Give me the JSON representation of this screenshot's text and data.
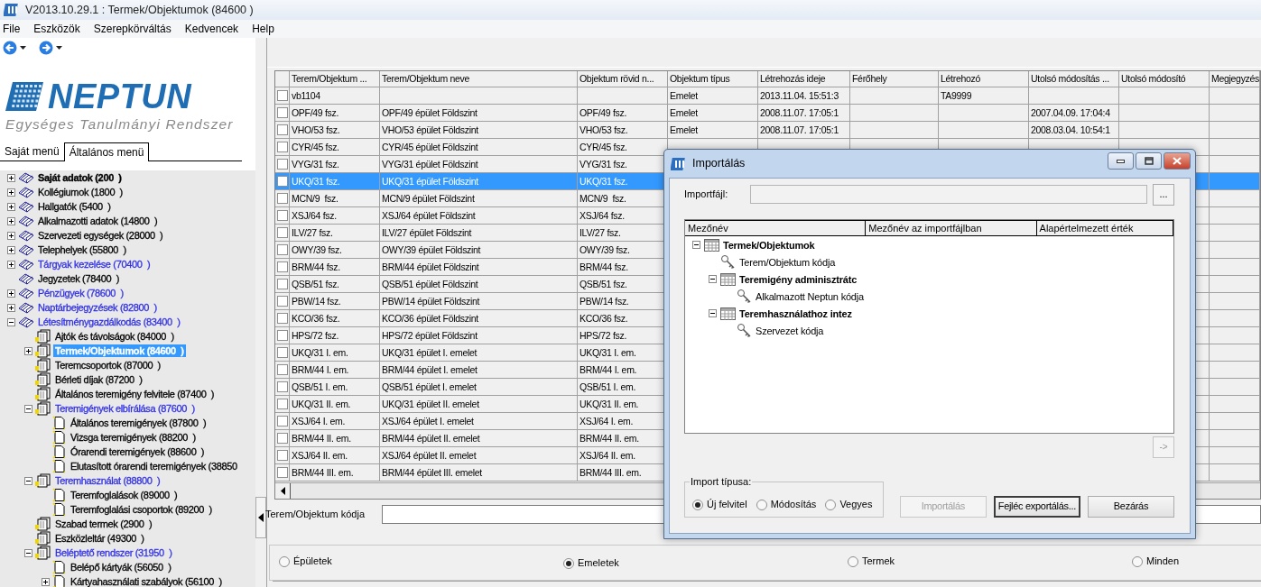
{
  "window": {
    "title": "V2013.10.29.1 : Termek/Objektumok (84600  )"
  },
  "menu": [
    "File",
    "Eszközök",
    "Szerepkörváltás",
    "Kedvencek",
    "Help"
  ],
  "logo": {
    "name": "NEPTUN",
    "tagline": "Egységes Tanulmányi Rendszer"
  },
  "sidebar": {
    "tabs": [
      {
        "label": "Saját menü",
        "selected": false
      },
      {
        "label": "Általános menü",
        "selected": true
      }
    ],
    "tree": [
      {
        "label": "Saját adatok (200  )",
        "kind": "book",
        "color": "#000000",
        "bold": true,
        "selected": false,
        "expanded": false
      },
      {
        "label": "Kollégiumok (1800  )",
        "kind": "book",
        "color": "#000000",
        "bold": false,
        "selected": false,
        "expanded": false
      },
      {
        "label": "Hallgatók (5400  )",
        "kind": "book",
        "color": "#000000",
        "bold": false,
        "selected": false,
        "expanded": false
      },
      {
        "label": "Alkalmazotti adatok (14800  )",
        "kind": "book",
        "color": "#000000",
        "bold": false,
        "selected": false,
        "expanded": false
      },
      {
        "label": "Szervezeti egységek (28000  )",
        "kind": "book",
        "color": "#000000",
        "bold": false,
        "selected": false,
        "expanded": false
      },
      {
        "label": "Telephelyek (55800  )",
        "kind": "book",
        "color": "#000000",
        "bold": false,
        "selected": false,
        "expanded": false
      },
      {
        "label": "Tárgyak kezelése (70400  )",
        "kind": "book",
        "color": "#3030e8",
        "bold": false,
        "selected": false,
        "expanded": false
      },
      {
        "label": "Jegyzetek (78400  )",
        "kind": "book",
        "color": "#000000",
        "bold": false,
        "selected": false
      },
      {
        "label": "Pénzügyek (78600  )",
        "kind": "book",
        "color": "#3030e8",
        "bold": false,
        "selected": false,
        "expanded": false
      },
      {
        "label": "Naptárbejegyzések (82800  )",
        "kind": "book",
        "color": "#3030e8",
        "bold": false,
        "selected": false,
        "expanded": false
      },
      {
        "label": "Létesítménygazdálkodás (83400  )",
        "kind": "book",
        "color": "#3030e8",
        "bold": false,
        "selected": false,
        "expanded": true,
        "children": [
          {
            "label": "Ajtók és távolságok (84000  )",
            "kind": "docs",
            "color": "#000000",
            "bold": false,
            "selected": false
          },
          {
            "label": "Termek/Objektumok (84600  )",
            "kind": "docs",
            "bold": true,
            "selected": true,
            "expanded": false
          },
          {
            "label": "Teremcsoportok (87000  )",
            "kind": "docs",
            "color": "#000000",
            "bold": false,
            "selected": false
          },
          {
            "label": "Bérleti díjak (87200  )",
            "kind": "docs",
            "color": "#000000",
            "bold": false,
            "selected": false
          },
          {
            "label": "Általános teremigény felvitele (87400  )",
            "kind": "docs",
            "color": "#000000",
            "bold": false,
            "selected": false
          },
          {
            "label": "Teremigények elbírálása (87600  )",
            "kind": "docs",
            "color": "#3030e8",
            "bold": false,
            "selected": false,
            "expanded": true,
            "children": [
              {
                "label": "Általános teremigények (87800  )",
                "kind": "page",
                "color": "#000000",
                "bold": false,
                "selected": false
              },
              {
                "label": "Vizsga teremigények (88200  )",
                "kind": "page",
                "color": "#000000",
                "bold": false,
                "selected": false
              },
              {
                "label": "Órarendi teremigények (88600  )",
                "kind": "page",
                "color": "#000000",
                "bold": false,
                "selected": false
              },
              {
                "label": "Elutasított órarendi teremigények (38850",
                "kind": "page",
                "color": "#000000",
                "bold": false,
                "selected": false
              }
            ]
          },
          {
            "label": "Teremhasználat (88800  )",
            "kind": "docs",
            "color": "#3030e8",
            "bold": false,
            "selected": false,
            "expanded": true,
            "children": [
              {
                "label": "Teremfoglalások (89000  )",
                "kind": "page",
                "color": "#000000",
                "bold": false,
                "selected": false
              },
              {
                "label": "Teremfoglalási csoportok (89200  )",
                "kind": "page",
                "color": "#000000",
                "bold": false,
                "selected": false
              }
            ]
          },
          {
            "label": "Szabad termek (2900  )",
            "kind": "docs",
            "color": "#000000",
            "bold": false,
            "selected": false
          },
          {
            "label": "Eszközleltár (49300  )",
            "kind": "docs",
            "color": "#000000",
            "bold": false,
            "selected": false
          },
          {
            "label": "Beléptető rendszer (31950  )",
            "kind": "docs",
            "color": "#3030e8",
            "bold": false,
            "selected": false,
            "expanded": true,
            "children": [
              {
                "label": "Belépő kártyák (56050  )",
                "kind": "page",
                "color": "#000000",
                "bold": false,
                "selected": false
              },
              {
                "label": "Kártyahasználati szabályok (56100  )",
                "kind": "page",
                "color": "#000000",
                "bold": false,
                "selected": false,
                "expanded": false
              }
            ]
          }
        ]
      }
    ]
  },
  "table": {
    "columns": [
      "Terem/Objektum ...",
      "Terem/Objektum neve",
      "Objektum rövid n...",
      "Objektum típus",
      "Létrehozás ideje",
      "Férőhely",
      "Létrehozó",
      "Utolsó módosítás ...",
      "Utolsó módosító",
      "Megjegyzés"
    ],
    "rows": [
      {
        "checked": false,
        "selected": false,
        "cells": [
          "vb1104",
          null,
          null,
          "Emelet",
          "2013.11.04. 15:51:3",
          null,
          "TA9999",
          null,
          null,
          null
        ]
      },
      {
        "checked": false,
        "selected": false,
        "cells": [
          "OPF/49 fsz.",
          "OPF/49 épület Földszint",
          "OPF/49 fsz.",
          "Emelet",
          "2008.11.07. 17:05:1",
          null,
          null,
          "2007.04.09. 17:04:4",
          null,
          null
        ]
      },
      {
        "checked": false,
        "selected": false,
        "cells": [
          "VHO/53 fsz.",
          "VHO/53 épület Földszint",
          "VHO/53 fsz.",
          "Emelet",
          "2008.11.07. 17:05:1",
          null,
          null,
          "2008.03.04. 10:54:1",
          null,
          null
        ]
      },
      {
        "checked": false,
        "selected": false,
        "cells": [
          "CYR/45 fsz.",
          "CYR/45 épület Földszint",
          "CYR/45 fsz."
        ]
      },
      {
        "checked": false,
        "selected": false,
        "cells": [
          "VYG/31 fsz.",
          "VYG/31 épület Földszint",
          "VYG/31 fsz."
        ]
      },
      {
        "checked": false,
        "selected": true,
        "cells": [
          "UKQ/31 fsz.",
          "UKQ/31 épület Földszint",
          "UKQ/31 fsz."
        ]
      },
      {
        "checked": false,
        "selected": false,
        "cells": [
          "MCN/9  fsz.",
          "MCN/9 épület Földszint",
          "MCN/9  fsz."
        ]
      },
      {
        "checked": false,
        "selected": false,
        "cells": [
          "XSJ/64 fsz.",
          "XSJ/64 épület Földszint",
          "XSJ/64 fsz."
        ]
      },
      {
        "checked": false,
        "selected": false,
        "cells": [
          "ILV/27 fsz.",
          "ILV/27 épület Földszint",
          "ILV/27 fsz."
        ]
      },
      {
        "checked": false,
        "selected": false,
        "cells": [
          "OWY/39 fsz.",
          "OWY/39 épület Földszint",
          "OWY/39 fsz."
        ]
      },
      {
        "checked": false,
        "selected": false,
        "cells": [
          "BRM/44 fsz.",
          "BRM/44 épület Földszint",
          "BRM/44 fsz."
        ]
      },
      {
        "checked": false,
        "selected": false,
        "cells": [
          "QSB/51 fsz.",
          "QSB/51 épület Földszint",
          "QSB/51 fsz."
        ]
      },
      {
        "checked": false,
        "selected": false,
        "cells": [
          "PBW/14 fsz.",
          "PBW/14 épület Földszint",
          "PBW/14 fsz."
        ]
      },
      {
        "checked": false,
        "selected": false,
        "cells": [
          "KCO/36 fsz.",
          "KCO/36 épület Földszint",
          "KCO/36 fsz."
        ]
      },
      {
        "checked": false,
        "selected": false,
        "cells": [
          "HPS/72 fsz.",
          "HPS/72 épület Földszint",
          "HPS/72 fsz."
        ]
      },
      {
        "checked": false,
        "selected": false,
        "cells": [
          "UKQ/31 I. em.",
          "UKQ/31 épület I. emelet",
          "UKQ/31 I. em."
        ]
      },
      {
        "checked": false,
        "selected": false,
        "cells": [
          "BRM/44 I. em.",
          "BRM/44 épület I. emelet",
          "BRM/44 I. em."
        ]
      },
      {
        "checked": false,
        "selected": false,
        "cells": [
          "QSB/51 I. em.",
          "QSB/51 épület I. emelet",
          "QSB/51 I. em."
        ]
      },
      {
        "checked": false,
        "selected": false,
        "cells": [
          "UKQ/31 II. em.",
          "UKQ/31 épület II. emelet",
          "UKQ/31 II. em."
        ]
      },
      {
        "checked": false,
        "selected": false,
        "cells": [
          "XSJ/64 I. em.",
          "XSJ/64 épület I. emelet",
          "XSJ/64 I. em."
        ]
      },
      {
        "checked": false,
        "selected": false,
        "cells": [
          "BRM/44 II. em.",
          "BRM/44 épület II. emelet",
          "BRM/44 II. em."
        ]
      },
      {
        "checked": false,
        "selected": false,
        "cells": [
          "XSJ/64 II. em.",
          "XSJ/64 épület II. emelet",
          "XSJ/64 II. em."
        ]
      },
      {
        "checked": false,
        "selected": false,
        "cells": [
          "BRM/44 III. em.",
          "BRM/44 épület III. emelet",
          "BRM/44 III. em."
        ]
      }
    ]
  },
  "filter": {
    "label": "Terem/Objektum kódja"
  },
  "level_filter": [
    {
      "label": "Épületek",
      "selected": false
    },
    {
      "label": "Emeletek",
      "selected": true
    },
    {
      "label": "Termek",
      "selected": false
    },
    {
      "label": "Minden",
      "selected": false
    }
  ],
  "dialog": {
    "title": "Importálás",
    "file_label": "Importfájl:",
    "browse_button": "...",
    "columns": [
      "Mezőnév",
      "Mezőnév az importfájlban",
      "Alapértelmezett érték"
    ],
    "tree": [
      {
        "label": "Termek/Objektumok",
        "kind": "table",
        "expanded": true,
        "children": [
          {
            "label": "Terem/Objektum kódja",
            "kind": "key"
          },
          {
            "label": "Teremigény adminisztrátc",
            "kind": "table",
            "expanded": true,
            "children": [
              {
                "label": "Alkalmazott Neptun kódja",
                "kind": "key"
              }
            ]
          },
          {
            "label": "Teremhasználathoz intez",
            "kind": "table",
            "expanded": true,
            "children": [
              {
                "label": "Szervezet kódja",
                "kind": "key"
              }
            ]
          }
        ]
      }
    ],
    "arrow_button": "->",
    "import_type": {
      "label": "Import típusa:",
      "options": [
        {
          "label": "Új felvitel",
          "selected": true
        },
        {
          "label": "Módosítás",
          "selected": false
        },
        {
          "label": "Vegyes",
          "selected": false
        }
      ]
    },
    "buttons": [
      {
        "label": "Importálás",
        "disabled": true,
        "focused": false
      },
      {
        "label": "Fejléc exportálás...",
        "disabled": false,
        "focused": true
      },
      {
        "label": "Bezárás",
        "disabled": false,
        "focused": false
      }
    ]
  }
}
